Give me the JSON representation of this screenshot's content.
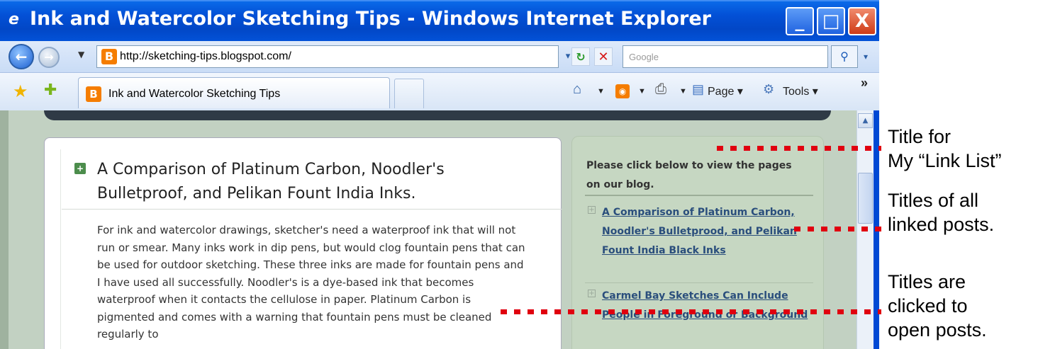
{
  "window": {
    "title": "Ink and Watercolor Sketching Tips - Windows Internet Explorer",
    "min_glyph": "_",
    "max_glyph": "□",
    "close_glyph": "X"
  },
  "address_bar": {
    "url": "http://sketching-tips.blogspot.com/",
    "search_placeholder": "Google"
  },
  "tab": {
    "label": "Ink and Watercolor Sketching Tips"
  },
  "command_bar": {
    "page_label": "Page ▾",
    "tools_label": "Tools ▾",
    "more": "»"
  },
  "post": {
    "title": "A Comparison of Platinum Carbon, Noodler's Bulletproof, and Pelikan Fount India Inks.",
    "body": "For ink and watercolor drawings, sketcher's need a waterproof ink that will not run or smear. Many inks work in dip pens, but would clog fountain pens that can be used for outdoor sketching. These three inks are made for fountain pens and I have used all successfully. Noodler's is a dye-based ink that becomes waterproof when it contacts the cellulose in paper. Platinum Carbon is pigmented and comes with a warning that fountain pens must be cleaned regularly to"
  },
  "sidebar": {
    "title": "Please click below to view the pages on our blog.",
    "items": [
      {
        "label": "A Comparison of Platinum Carbon, Noodler's Bulletprood, and Pelikan Fount India Black Inks"
      },
      {
        "label": "Carmel Bay Sketches Can Include People in Foreground or Background"
      }
    ]
  },
  "annotations": {
    "note_1": [
      "Title for",
      "My “Link List”"
    ],
    "note_2": [
      "Titles of all",
      "linked posts."
    ],
    "note_3": [
      "Titles are",
      "clicked to",
      "open posts."
    ],
    "dot_color": "#e0000f"
  },
  "colors": {
    "titlebar": "#0247c6",
    "page_bg": "#c2d1c2",
    "sidebar_bg": "#c6d7c2",
    "link": "#2a4e7c"
  }
}
